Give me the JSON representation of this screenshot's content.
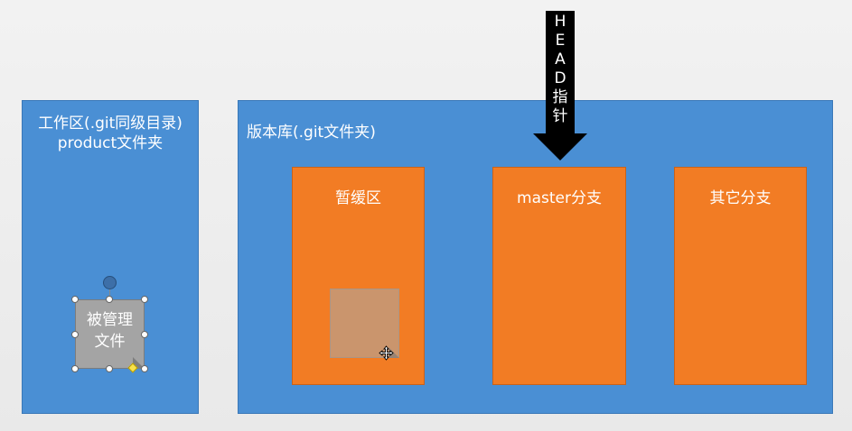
{
  "working_dir": {
    "title": "工作区(.git同级目录)\nproduct文件夹"
  },
  "managed_file": {
    "label": "被管理\n文件"
  },
  "repo": {
    "title": "版本库(.git文件夹)",
    "boxes": {
      "stage": "暂缓区",
      "master": "master分支",
      "other": "其它分支"
    }
  },
  "head_pointer": {
    "chars": [
      "H",
      "E",
      "A",
      "D",
      "指",
      "针"
    ]
  },
  "colors": {
    "panel": "#4a8fd4",
    "box": "#f27c24",
    "arrow": "#000000",
    "file": "#a4a4a4",
    "background": "#efefef"
  }
}
